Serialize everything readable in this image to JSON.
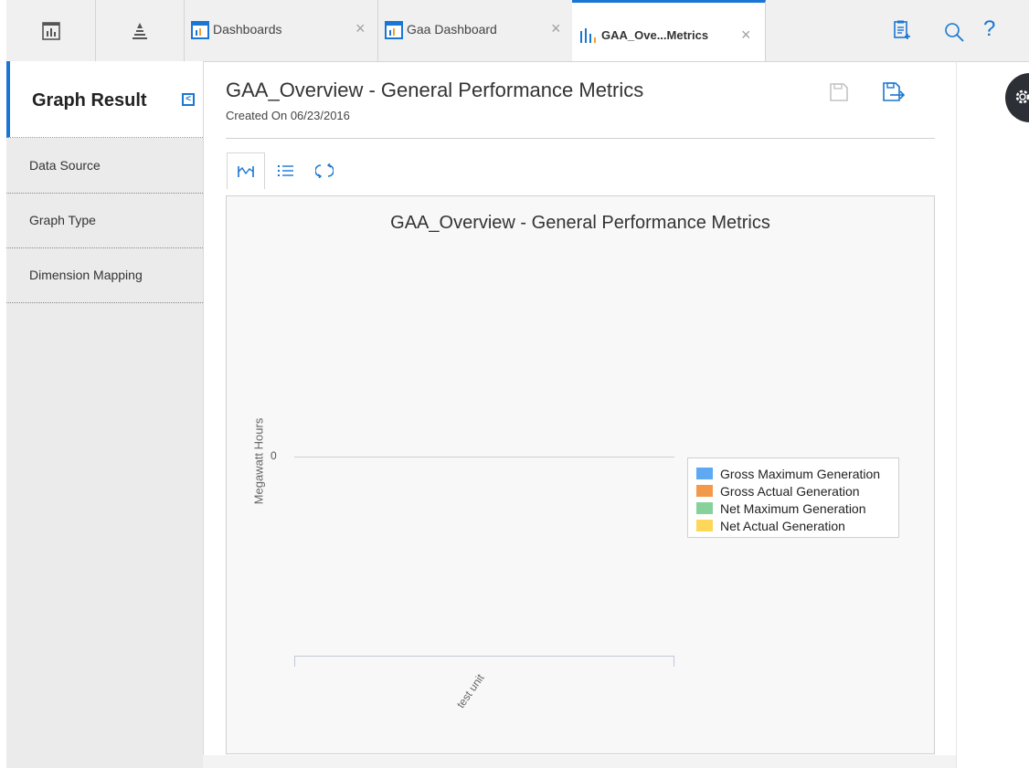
{
  "topbar": {
    "buttons": [
      {
        "name": "dashboards-home-button",
        "icon": "bar-chart-box-icon"
      },
      {
        "name": "pyramid-button",
        "icon": "pyramid-icon"
      }
    ],
    "tabs": [
      {
        "label": "Dashboards",
        "icon": "dashboard-icon",
        "active": false
      },
      {
        "label": "Gaa Dashboard",
        "icon": "dashboard-icon",
        "active": false
      },
      {
        "label": "GAA_Ove...Metrics",
        "icon": "bar-chart-icon",
        "active": true
      }
    ],
    "close_symbol": "×",
    "utilities": [
      {
        "icon": "clipboard-add-icon"
      },
      {
        "icon": "search-icon"
      },
      {
        "icon": "help-icon",
        "glyph": "?"
      }
    ]
  },
  "sidebar": {
    "title": "Graph Result",
    "collapse_glyph": "<",
    "items": [
      {
        "label": "Data Source"
      },
      {
        "label": "Graph Type"
      },
      {
        "label": "Dimension Mapping"
      }
    ]
  },
  "main": {
    "title": "GAA_Overview - General Performance Metrics",
    "subtitle": "Created On 06/23/2016",
    "actions": [
      {
        "icon": "save-icon",
        "enabled": false
      },
      {
        "icon": "save-as-icon",
        "enabled": true
      }
    ],
    "toolbar": [
      {
        "icon": "chart-view-icon",
        "selected": true
      },
      {
        "icon": "list-view-icon",
        "selected": false
      },
      {
        "icon": "refresh-icon",
        "selected": false
      }
    ]
  },
  "colors": {
    "accent": "#1976d2",
    "series": [
      "#5ea9f2",
      "#f39a4a",
      "#86d29a",
      "#fdd65a"
    ]
  },
  "chart_data": {
    "type": "bar",
    "title": "GAA_Overview - General Performance Metrics",
    "ylabel": "Megawatt Hours",
    "xlabel": "",
    "y_ticks": [
      "0"
    ],
    "categories": [
      "test unit"
    ],
    "series": [
      {
        "name": "Gross Maximum Generation",
        "values": [
          0
        ]
      },
      {
        "name": "Gross Actual Generation",
        "values": [
          0
        ]
      },
      {
        "name": "Net Maximum Generation",
        "values": [
          0
        ]
      },
      {
        "name": "Net Actual Generation",
        "values": [
          0
        ]
      }
    ],
    "legend_position": "right",
    "grid": false
  }
}
